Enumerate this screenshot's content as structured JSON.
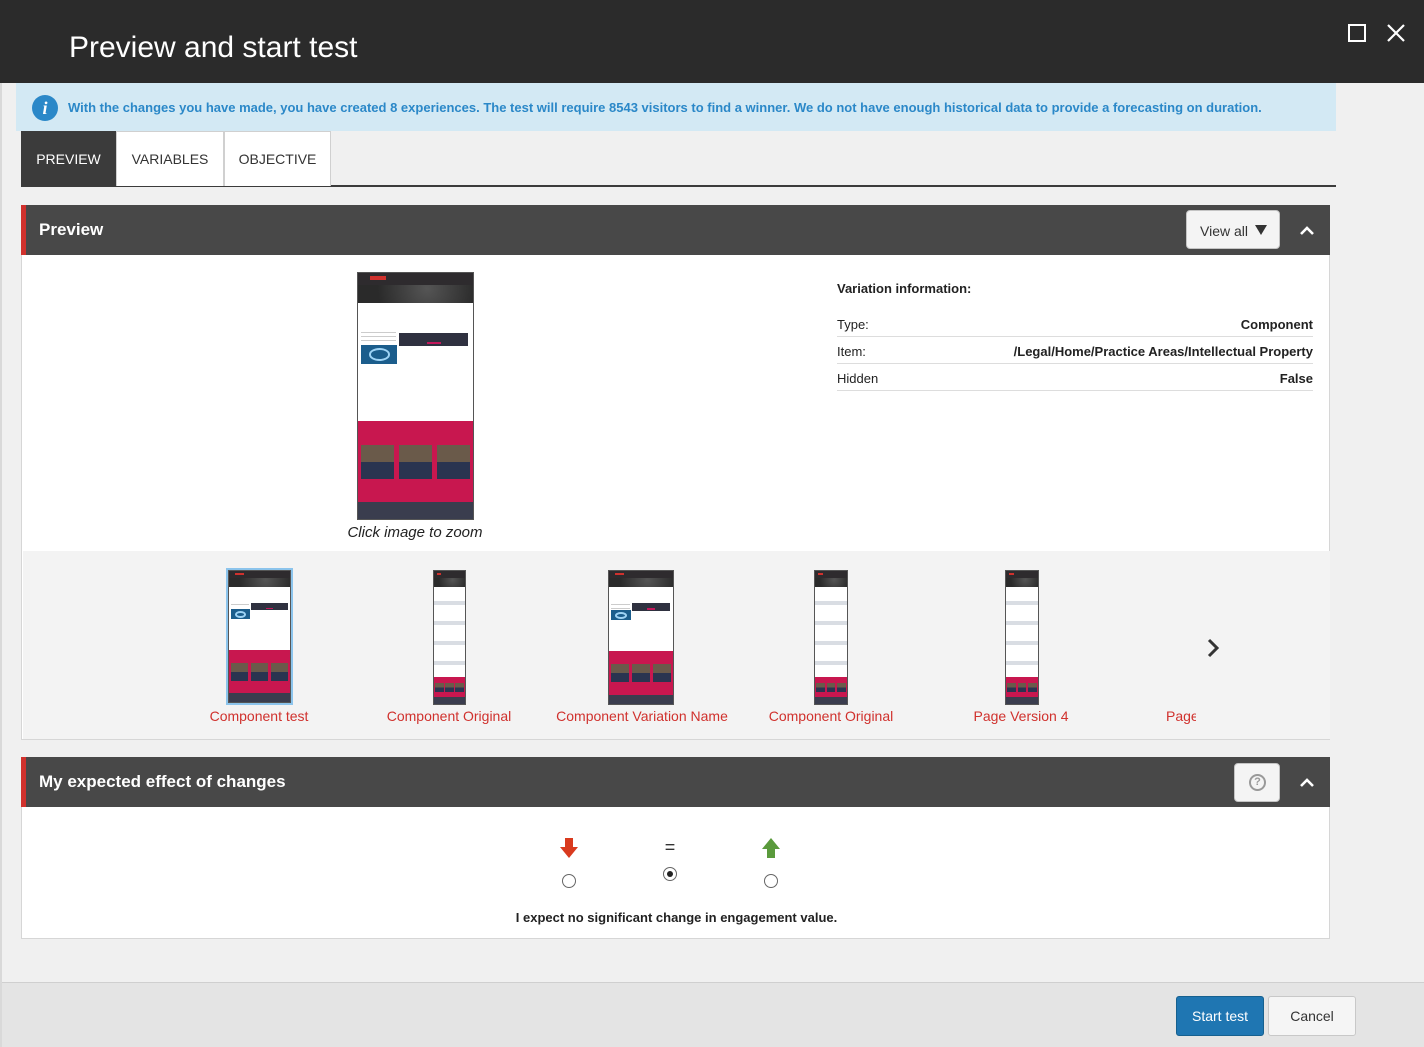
{
  "dialog": {
    "title": "Preview and start test"
  },
  "info": {
    "message": "With the changes you have made, you have created 8 experiences. The test will require 8543 visitors to find a winner. We do not have enough historical data to provide a forecasting on duration.",
    "icon": "info-icon"
  },
  "tabs": [
    {
      "label": "PREVIEW",
      "active": true
    },
    {
      "label": "VARIABLES",
      "active": false
    },
    {
      "label": "OBJECTIVE",
      "active": false
    }
  ],
  "preview": {
    "header": "Preview",
    "view_all_label": "View all",
    "zoom_caption": "Click image to zoom",
    "variation_info": {
      "title": "Variation information:",
      "rows": [
        {
          "key": "Type:",
          "value": "Component"
        },
        {
          "key": "Item:",
          "value": "/Legal/Home/Practice Areas/Intellectual Property"
        },
        {
          "key": "Hidden",
          "value": "False"
        }
      ]
    },
    "thumbnails": [
      {
        "label": "Component test",
        "selected": true
      },
      {
        "label": "Component Original",
        "selected": false
      },
      {
        "label": "Component Variation Name",
        "selected": false
      },
      {
        "label": "Component Original",
        "selected": false
      },
      {
        "label": "Page Version 4",
        "selected": false
      },
      {
        "label": "Page",
        "selected": false
      }
    ]
  },
  "effect": {
    "header": "My expected effect of changes",
    "options": [
      {
        "symbol": "down-arrow-icon",
        "checked": false
      },
      {
        "symbol": "=",
        "checked": true
      },
      {
        "symbol": "up-arrow-icon",
        "checked": false
      }
    ],
    "description": "I expect no significant change in engagement value.",
    "colors": {
      "down": "#d93a1e",
      "up": "#5a9a3c"
    }
  },
  "footer": {
    "start_label": "Start test",
    "cancel_label": "Cancel"
  },
  "colors": {
    "accent": "#d0312d",
    "primary_button": "#1f76b2",
    "info_text": "#2b88c8",
    "info_bg": "#d3e9f4"
  }
}
